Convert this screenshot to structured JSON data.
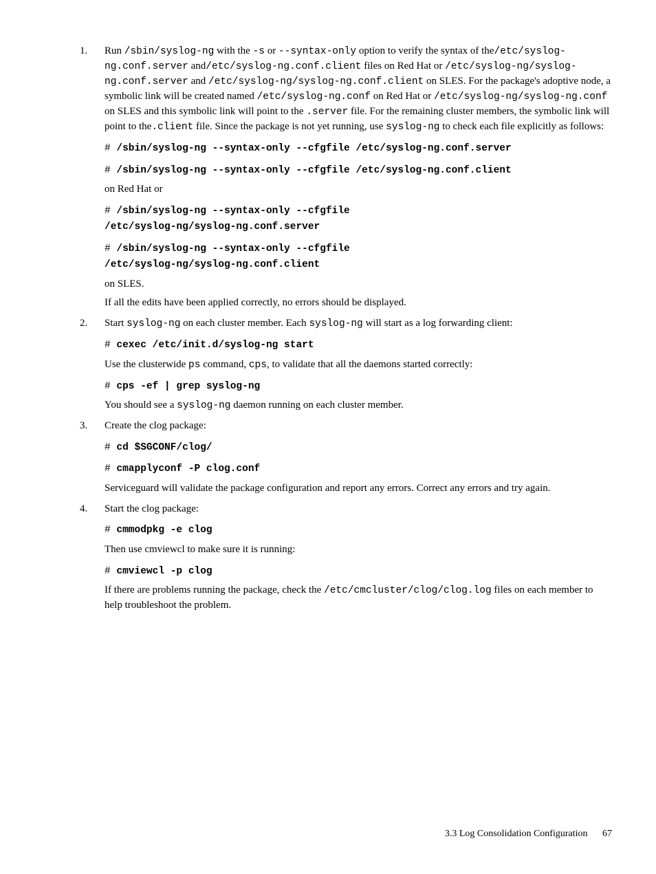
{
  "steps": [
    {
      "num": "1.",
      "p1_a": "Run ",
      "p1_code1": "/sbin/syslog-ng",
      "p1_b": " with the ",
      "p1_code2": "-s",
      "p1_c": " or ",
      "p1_code3": "--syntax-only",
      "p1_d": " option to verify the syntax of the",
      "p1_code4": "/etc/syslog-ng.conf.server",
      "p1_e": " and",
      "p1_code5": "/etc/syslog-ng.conf.client",
      "p1_f": " files on Red Hat or ",
      "p1_code6": "/etc/syslog-ng/syslog-ng.conf.server",
      "p1_g": " and ",
      "p1_code7": "/etc/syslog-ng/syslog-ng.conf.client",
      "p1_h": " on SLES. For the package's adoptive node, a symbolic link will be created named ",
      "p1_code8": "/etc/syslog-ng.conf",
      "p1_i": " on Red Hat or ",
      "p1_code9": "/etc/syslog-ng/syslog-ng.conf",
      "p1_j": " on SLES and this symbolic link will point to the ",
      "p1_code10": ".server",
      "p1_k": " file. For the remaining cluster members, the symbolic link will point to the",
      "p1_code11": ".client",
      "p1_l": " file. Since the package is not yet running, use ",
      "p1_code12": "syslog-ng",
      "p1_m": " to check each file explicitly as follows:",
      "cmd1_hash": "# ",
      "cmd1": "/sbin/syslog-ng --syntax-only --cfgfile /etc/syslog-ng.conf.server",
      "cmd2_hash": "# ",
      "cmd2": "/sbin/syslog-ng --syntax-only --cfgfile /etc/syslog-ng.conf.client",
      "p2": "on Red Hat or",
      "cmd3_hash": "# ",
      "cmd3_l1": "/sbin/syslog-ng --syntax-only --cfgfile",
      "cmd3_l2": "/etc/syslog-ng/syslog-ng.conf.server",
      "cmd4_hash": "# ",
      "cmd4_l1": "/sbin/syslog-ng --syntax-only --cfgfile",
      "cmd4_l2": "/etc/syslog-ng/syslog-ng.conf.client",
      "p3": "on SLES.",
      "p4": "If all the edits have been applied correctly, no errors should be displayed."
    },
    {
      "num": "2.",
      "p1_a": "Start ",
      "p1_code1": "syslog-ng",
      "p1_b": " on each cluster member. Each ",
      "p1_code2": "syslog-ng",
      "p1_c": " will start as a log forwarding client:",
      "cmd1_hash": "# ",
      "cmd1": "cexec /etc/init.d/syslog-ng start",
      "p2_a": "Use the clusterwide ",
      "p2_code1": "ps",
      "p2_b": " command, ",
      "p2_code2": "cps",
      "p2_c": ", to validate that all the daemons started correctly:",
      "cmd2_hash": "# ",
      "cmd2": "cps -ef | grep syslog-ng",
      "p3_a": "You should see a ",
      "p3_code1": "syslog-ng",
      "p3_b": " daemon running on each cluster member."
    },
    {
      "num": "3.",
      "p1": "Create the clog package:",
      "cmd1_hash": "# ",
      "cmd1": "cd $SGCONF/clog/",
      "cmd2_hash": "# ",
      "cmd2": "cmapplyconf -P clog.conf",
      "p2": "Serviceguard will validate the package configuration and report any errors. Correct any errors and try again."
    },
    {
      "num": "4.",
      "p1": "Start the clog package:",
      "cmd1_hash": "# ",
      "cmd1": "cmmodpkg -e clog",
      "p2": "Then use cmviewcl to make sure it is running:",
      "cmd2_hash": "# ",
      "cmd2": "cmviewcl -p clog",
      "p3_a": "If there are problems running the package, check the ",
      "p3_code1": "/etc/cmcluster/clog/clog.log",
      "p3_b": " files on each member to help troubleshoot the problem."
    }
  ],
  "footer": {
    "section": "3.3 Log Consolidation Configuration",
    "page": "67"
  }
}
